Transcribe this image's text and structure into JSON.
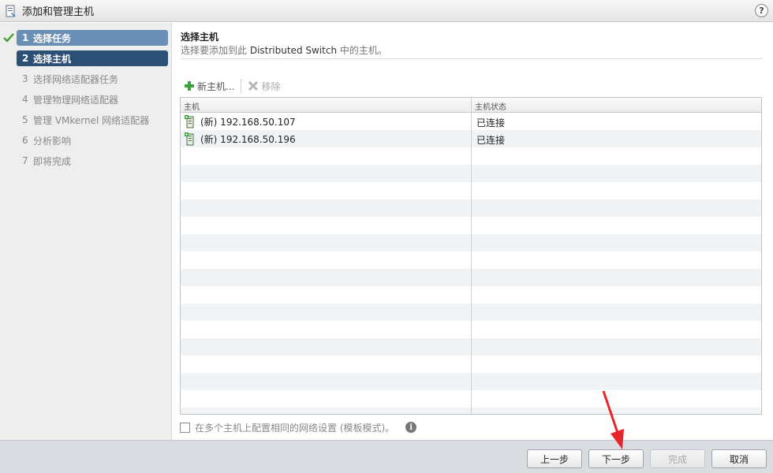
{
  "window": {
    "title": "添加和管理主机",
    "help_label": "?"
  },
  "sidebar": {
    "steps": [
      {
        "num": "1",
        "label": "选择任务"
      },
      {
        "num": "2",
        "label": "选择主机"
      },
      {
        "num": "3",
        "label": "选择网络适配器任务"
      },
      {
        "num": "4",
        "label": "管理物理网络适配器"
      },
      {
        "num": "5",
        "label": "管理 VMkernel 网络适配器"
      },
      {
        "num": "6",
        "label": "分析影响"
      },
      {
        "num": "7",
        "label": "即将完成"
      }
    ]
  },
  "main": {
    "title": "选择主机",
    "subtitle_prefix": "选择要添加到此 ",
    "subtitle_switch": "Distributed Switch",
    "subtitle_suffix": " 中的主机。",
    "toolbar": {
      "new_host": "新主机...",
      "remove": "移除"
    },
    "table": {
      "columns": [
        "主机",
        "主机状态"
      ],
      "rows": [
        {
          "host": "(新) 192.168.50.107",
          "status": "已连接"
        },
        {
          "host": "(新) 192.168.50.196",
          "status": "已连接"
        }
      ]
    },
    "template_mode_label": "在多个主机上配置相同的网络设置 (模板模式)。"
  },
  "footer": {
    "back": "上一步",
    "next": "下一步",
    "finish": "完成",
    "cancel": "取消"
  },
  "colors": {
    "active_step": "#2c4f76",
    "done_step": "#6a8fb4",
    "check_green": "#3a9a2a",
    "annotation_arrow": "#e8262a"
  }
}
